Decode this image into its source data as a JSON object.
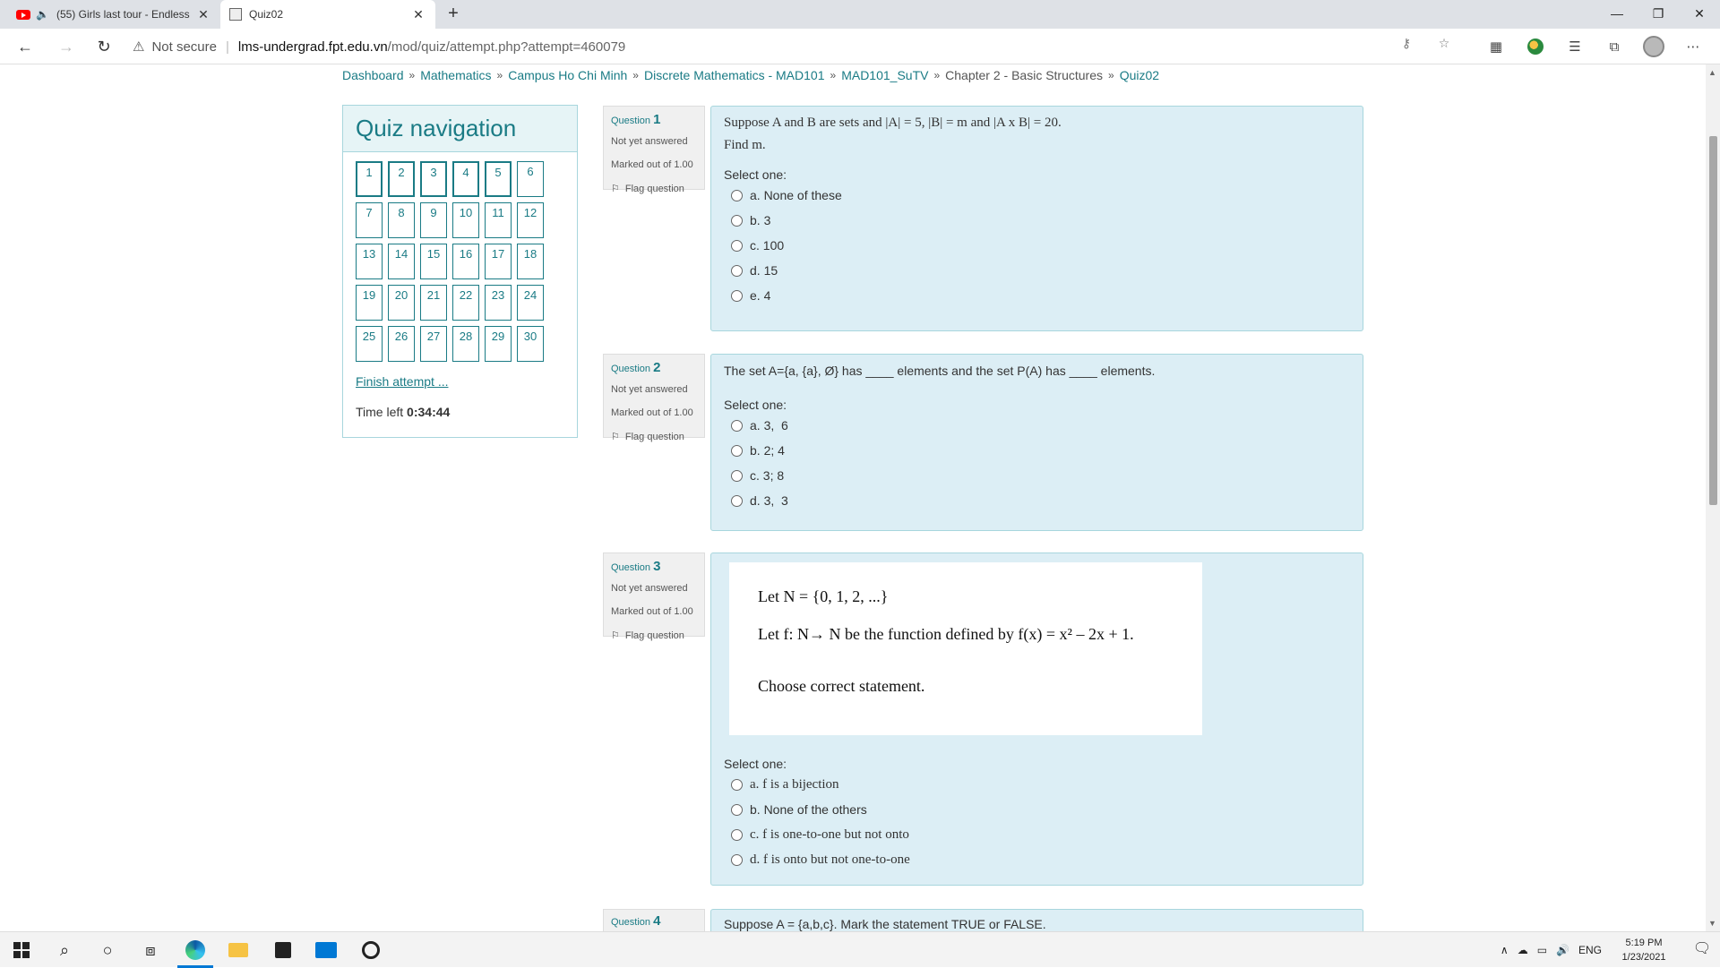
{
  "browser": {
    "tabs": [
      {
        "title": "(55) Girls last tour - Endless"
      },
      {
        "title": "Quiz02"
      }
    ],
    "not_secure": "Not secure",
    "url_host": "lms-undergrad.fpt.edu.vn",
    "url_path": "/mod/quiz/attempt.php?attempt=460079"
  },
  "breadcrumb": [
    "Dashboard",
    "Mathematics",
    "Campus Ho Chi Minh",
    "Discrete Mathematics - MAD101",
    "MAD101_SuTV",
    "Chapter 2 - Basic Structures",
    "Quiz02"
  ],
  "breadcrumb_sep": "»",
  "quiz_nav": {
    "title": "Quiz navigation",
    "buttons": [
      "1",
      "2",
      "3",
      "4",
      "5",
      "6",
      "7",
      "8",
      "9",
      "10",
      "11",
      "12",
      "13",
      "14",
      "15",
      "16",
      "17",
      "18",
      "19",
      "20",
      "21",
      "22",
      "23",
      "24",
      "25",
      "26",
      "27",
      "28",
      "29",
      "30"
    ],
    "finish": "Finish attempt ...",
    "time_label": "Time left ",
    "time_value": "0:34:44"
  },
  "questions": [
    {
      "label": "Question ",
      "number": "1",
      "state": "Not yet answered",
      "mark": "Marked out of 1.00",
      "flag": "Flag question",
      "text_line1": "Suppose A and B are sets and |A| = 5, |B| = m and |A x B| = 20.",
      "text_line2": "Find m.",
      "select_one": "Select one:",
      "answers": [
        "a. None of these",
        "b. 3",
        "c. 100",
        "d. 15",
        "e. 4"
      ]
    },
    {
      "label": "Question ",
      "number": "2",
      "state": "Not yet answered",
      "mark": "Marked out of 1.00",
      "flag": "Flag question",
      "text_line1": "The set A={a, {a}, Ø} has ____ elements and the set P(A) has ____ elements.",
      "select_one": "Select one:",
      "answers": [
        "a. 3,  6",
        "b. 2; 4",
        "c. 3; 8",
        "d. 3,  3"
      ]
    },
    {
      "label": "Question ",
      "number": "3",
      "state": "Not yet answered",
      "mark": "Marked out of 1.00",
      "flag": "Flag question",
      "image_line1": "Let N = {0, 1, 2, ...}",
      "image_line2": "Let f: N→ N be the function defined by f(x) = x² – 2x + 1.",
      "image_line3": "Choose correct statement.",
      "select_one": "Select one:",
      "answers": [
        "a. f is a bijection",
        "b. None of the others",
        "c. f is one-to-one but not onto",
        "d. f is onto but not one-to-one"
      ]
    },
    {
      "label": "Question ",
      "number": "4",
      "text_line1": "Suppose A = {a,b,c}. Mark the statement TRUE or FALSE."
    }
  ],
  "taskbar": {
    "lang": "ENG",
    "time": "5:19 PM",
    "date": "1/23/2021"
  },
  "colors": {
    "accent": "#1a7b85",
    "question_bg": "#dceef5",
    "info_bg": "#f0f0f0"
  }
}
